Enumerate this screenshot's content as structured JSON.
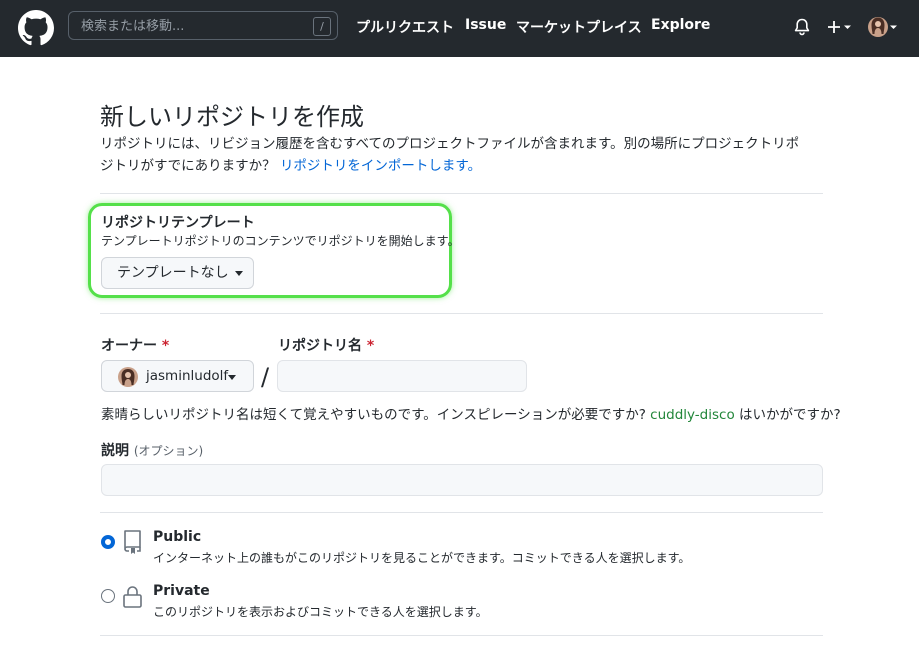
{
  "header": {
    "search_placeholder": "検索または移動...",
    "search_shortcut": "/",
    "nav": [
      "プルリクエスト",
      "Issue",
      "マーケットプレイス",
      "Explore"
    ]
  },
  "page": {
    "title": "新しいリポジトリを作成",
    "intro_text": "リポジトリには、リビジョン履歴を含むすべてのプロジェクトファイルが含まれます。別の場所にプロジェクトリポジトリがすでにありますか？",
    "import_link": "リポジトリをインポートします。"
  },
  "template": {
    "title": "リポジトリテンプレート",
    "description": "テンプレートリポジトリのコンテンツでリポジトリを開始します。",
    "button_label": "テンプレートなし"
  },
  "owner": {
    "label": "オーナー",
    "required_mark": "*",
    "value": "jasminludolf"
  },
  "repo_name": {
    "label": "リポジトリ名",
    "required_mark": "*",
    "separator": "/",
    "value": ""
  },
  "name_hint": {
    "prefix": "素晴らしいリポジトリ名は短くて覚えやすいものです。インスピレーションが必要ですか?",
    "suggestion": "cuddly-disco",
    "suffix": "はいかがですか?"
  },
  "description": {
    "label": "説明",
    "optional": "(オプション)",
    "value": ""
  },
  "visibility": {
    "selected": "public",
    "options": [
      {
        "title": "Public",
        "description": "インターネット上の誰もがこのリポジトリを見ることができます。コミットできる人を選択します。",
        "icon": "repo-icon"
      },
      {
        "title": "Private",
        "description": "このリポジトリを表示およびコミットできる人を選択します。",
        "icon": "lock-icon"
      }
    ]
  },
  "colors": {
    "header_bg": "#24292e",
    "link": "#0366d6",
    "highlight": "#55e04a",
    "required": "#cb2431",
    "suggestion": "#22863a"
  }
}
